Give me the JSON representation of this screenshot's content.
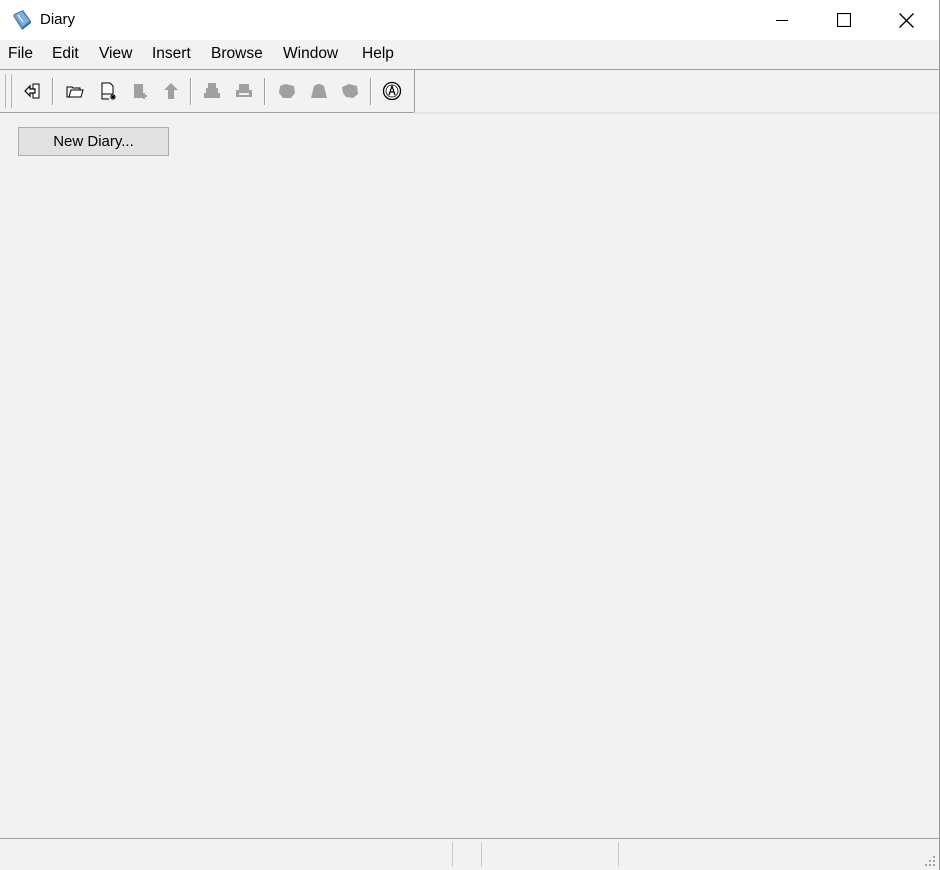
{
  "window": {
    "title": "Diary",
    "app_icon": "diary-book-icon",
    "controls": [
      "minimize-icon",
      "maximize-icon",
      "close-icon"
    ]
  },
  "menubar": {
    "items": [
      "File",
      "Edit",
      "View",
      "Insert",
      "Browse",
      "Window",
      "Help"
    ]
  },
  "toolbar": {
    "buttons": [
      {
        "icon": "exit-arrow-icon",
        "enabled": true
      },
      {
        "icon": "open-folder-icon",
        "enabled": true
      },
      {
        "icon": "new-document-icon",
        "enabled": true
      },
      {
        "icon": "add-page-icon",
        "enabled": false
      },
      {
        "icon": "up-level-icon",
        "enabled": false
      },
      {
        "icon": "stack-icon",
        "enabled": false
      },
      {
        "icon": "print-icon",
        "enabled": false
      },
      {
        "icon": "find-icon",
        "enabled": false
      },
      {
        "icon": "find-next-icon",
        "enabled": false
      },
      {
        "icon": "find-previous-icon",
        "enabled": false
      },
      {
        "icon": "about-icon",
        "enabled": true
      }
    ]
  },
  "main": {
    "new_diary_label": "New Diary..."
  },
  "colors": {
    "background": "#f2f2f2",
    "button_face": "#e1e1e1",
    "disabled_icon": "#a0a0a0"
  }
}
